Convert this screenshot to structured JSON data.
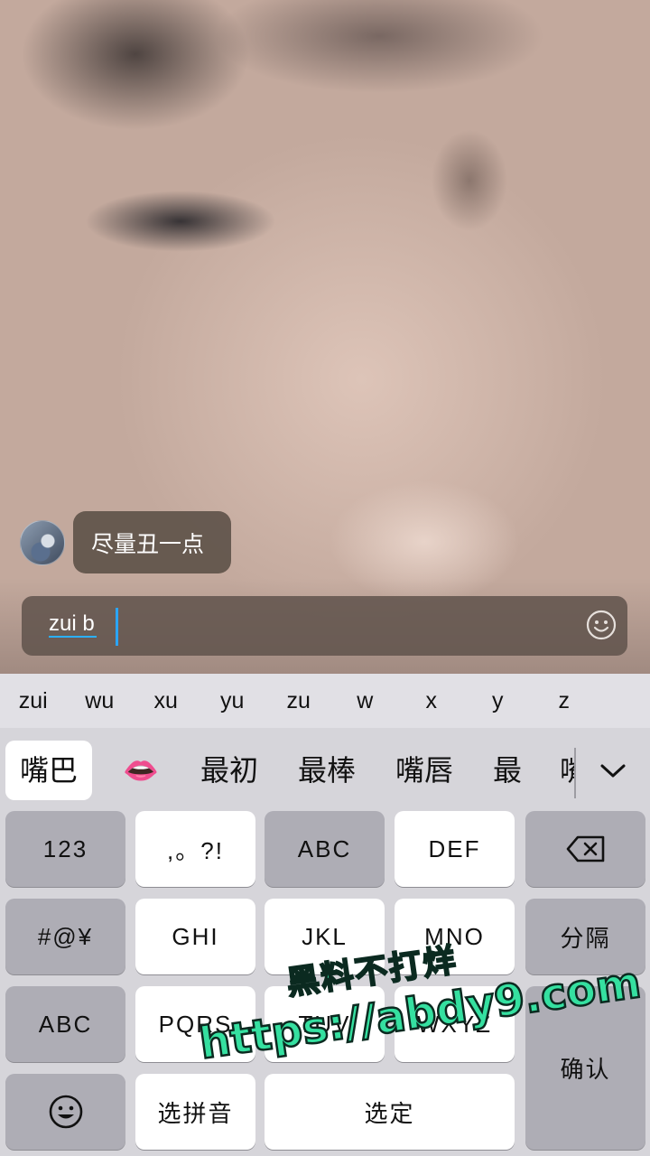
{
  "comment": {
    "text": "尽量丑一点"
  },
  "input": {
    "value": "zui b"
  },
  "keyboard": {
    "pinyin_options": [
      "zui",
      "wu",
      "xu",
      "yu",
      "zu",
      "w",
      "x",
      "y",
      "z"
    ],
    "candidates": {
      "c1": "嘴巴",
      "c2": "👄",
      "c3": "最初",
      "c4": "最棒",
      "c5": "嘴唇",
      "c6": "最",
      "c7": "嘴"
    },
    "keys": {
      "num": "123",
      "punct": ",。?!",
      "abc": "ABC",
      "def": "DEF",
      "symbols": "#@¥",
      "ghi": "GHI",
      "jkl": "JKL",
      "mno": "MNO",
      "separator": "分隔",
      "abc_switch": "ABC",
      "pqrs": "PQRS",
      "tuv": "TUV",
      "wxyz": "WXYZ",
      "confirm": "确认",
      "select_pinyin": "选拼音",
      "select": "选定"
    },
    "colors": {
      "light_key": "#ffffff",
      "dark_key": "#aeadb5",
      "accent": "#2aa5ff"
    }
  },
  "watermark": {
    "line1": "黑料不打烊",
    "line2": "https://abdy9.com",
    "color": "#35e0a0"
  }
}
